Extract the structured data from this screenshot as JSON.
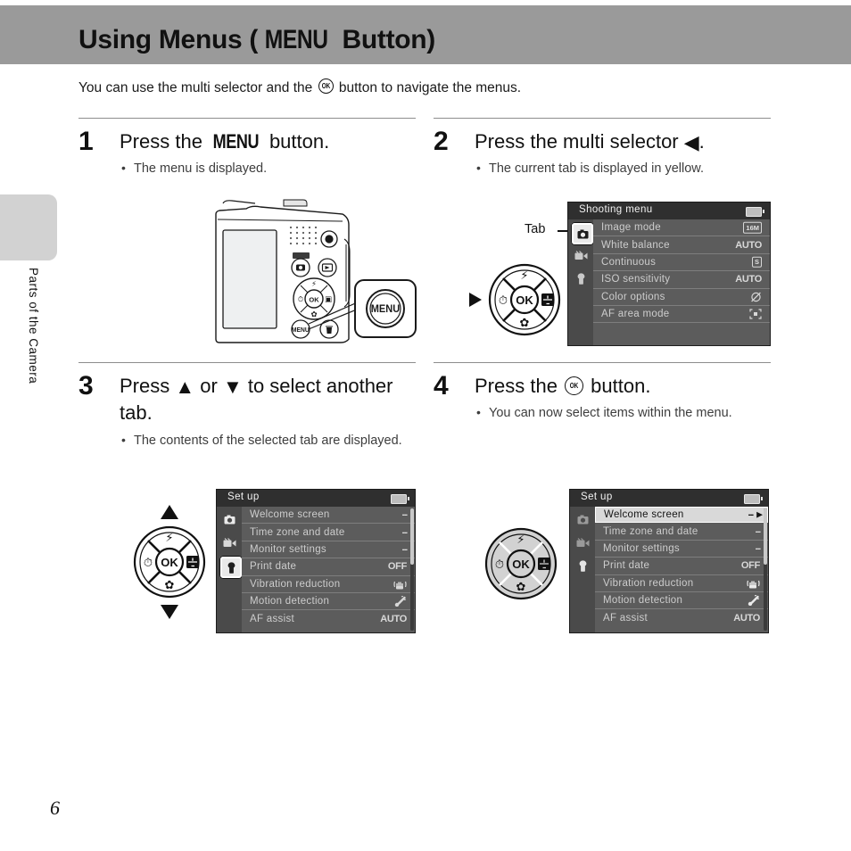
{
  "header": {
    "title_prefix": "Using Menus (",
    "title_menu_word": "MENU",
    "title_suffix": " Button)"
  },
  "intro": {
    "before_icon": "You can use the multi selector and the ",
    "icon": "ok-button-icon",
    "after_icon": " button to navigate the menus."
  },
  "sidebar": {
    "chapter_label": "Parts of the Camera"
  },
  "steps": [
    {
      "number": "1",
      "heading_before": "Press the ",
      "heading_menu_word": "MENU",
      "heading_after": " button.",
      "bullets": [
        "The menu is displayed."
      ]
    },
    {
      "number": "2",
      "heading_before": "Press the multi selector ",
      "heading_arrow": "◀",
      "heading_after": ".",
      "bullets": [
        "The current tab is displayed in yellow."
      ]
    },
    {
      "number": "3",
      "heading_before": "Press ",
      "heading_arrow_up": "▲",
      "heading_mid": " or ",
      "heading_arrow_down": "▼",
      "heading_after": " to select another tab.",
      "bullets": [
        "The contents of the selected tab are displayed."
      ]
    },
    {
      "number": "4",
      "heading_before": "Press the ",
      "icon": "ok-button-icon",
      "heading_after": " button.",
      "bullets": [
        "You can now select items within the menu."
      ]
    }
  ],
  "callout": {
    "tab_label": "Tab",
    "menu_button_label": "MENU"
  },
  "shooting_menu": {
    "title": "Shooting menu",
    "battery_icon": "battery-icon",
    "tabs": [
      {
        "name": "camera-tab",
        "icon": "camera-icon",
        "selected": true
      },
      {
        "name": "movie-tab",
        "icon": "movie-camera-icon",
        "selected": false
      },
      {
        "name": "setup-tab",
        "icon": "wrench-icon",
        "selected": false
      }
    ],
    "rows": [
      {
        "label": "Image mode",
        "value": "16M",
        "value_type": "badge"
      },
      {
        "label": "White balance",
        "value": "AUTO",
        "value_type": "text"
      },
      {
        "label": "Continuous",
        "value": "S",
        "value_type": "badge"
      },
      {
        "label": "ISO sensitivity",
        "value": "AUTO",
        "value_type": "text"
      },
      {
        "label": "Color options",
        "value": "color-off-icon",
        "value_type": "icon"
      },
      {
        "label": "AF area mode",
        "value": "af-area-icon",
        "value_type": "icon"
      }
    ]
  },
  "setup_menu_step3": {
    "title": "Set up",
    "battery_icon": "battery-icon",
    "tabs": [
      {
        "name": "camera-tab",
        "icon": "camera-icon",
        "selected": false
      },
      {
        "name": "movie-tab",
        "icon": "movie-camera-icon",
        "selected": false
      },
      {
        "name": "setup-tab",
        "icon": "wrench-icon",
        "selected": true
      }
    ],
    "rows": [
      {
        "label": "Welcome screen",
        "value": "--",
        "value_type": "dashes",
        "selected": false
      },
      {
        "label": "Time zone and date",
        "value": "--",
        "value_type": "dashes",
        "selected": false
      },
      {
        "label": "Monitor settings",
        "value": "--",
        "value_type": "dashes",
        "selected": false
      },
      {
        "label": "Print date",
        "value": "OFF",
        "value_type": "text",
        "selected": false
      },
      {
        "label": "Vibration reduction",
        "value": "vibration-reduction-icon",
        "value_type": "icon",
        "selected": false
      },
      {
        "label": "Motion detection",
        "value": "motion-detection-icon",
        "value_type": "icon",
        "selected": false
      },
      {
        "label": "AF assist",
        "value": "AUTO",
        "value_type": "text",
        "selected": false
      }
    ]
  },
  "setup_menu_step4": {
    "title": "Set up",
    "battery_icon": "battery-icon",
    "tabs": [
      {
        "name": "camera-tab",
        "icon": "camera-icon",
        "selected": false
      },
      {
        "name": "movie-tab",
        "icon": "movie-camera-icon",
        "selected": false
      },
      {
        "name": "setup-tab",
        "icon": "wrench-icon",
        "selected": false
      }
    ],
    "rows": [
      {
        "label": "Welcome screen",
        "value": "--",
        "value_type": "dashes",
        "selected": true
      },
      {
        "label": "Time zone and date",
        "value": "--",
        "value_type": "dashes",
        "selected": false
      },
      {
        "label": "Monitor settings",
        "value": "--",
        "value_type": "dashes",
        "selected": false
      },
      {
        "label": "Print date",
        "value": "OFF",
        "value_type": "text",
        "selected": false
      },
      {
        "label": "Vibration reduction",
        "value": "vibration-reduction-icon",
        "value_type": "icon",
        "selected": false
      },
      {
        "label": "Motion detection",
        "value": "motion-detection-icon",
        "value_type": "icon",
        "selected": false
      },
      {
        "label": "AF assist",
        "value": "AUTO",
        "value_type": "text",
        "selected": false
      }
    ]
  },
  "multi_selector": {
    "ok_label": "OK",
    "buttons": [
      "flash-icon",
      "self-timer-icon",
      "exposure-compensation-icon",
      "macro-icon"
    ]
  },
  "footer": {
    "page_number": "6"
  },
  "colors": {
    "header_band": "#9a9a9a",
    "sidebar_tab": "#d2d2d2",
    "screen_bg": "#5c5c5c",
    "screen_title_bg": "#2f2f2f",
    "tab_column": "#4a4a4a",
    "selected_row": "#d9d9d9"
  }
}
